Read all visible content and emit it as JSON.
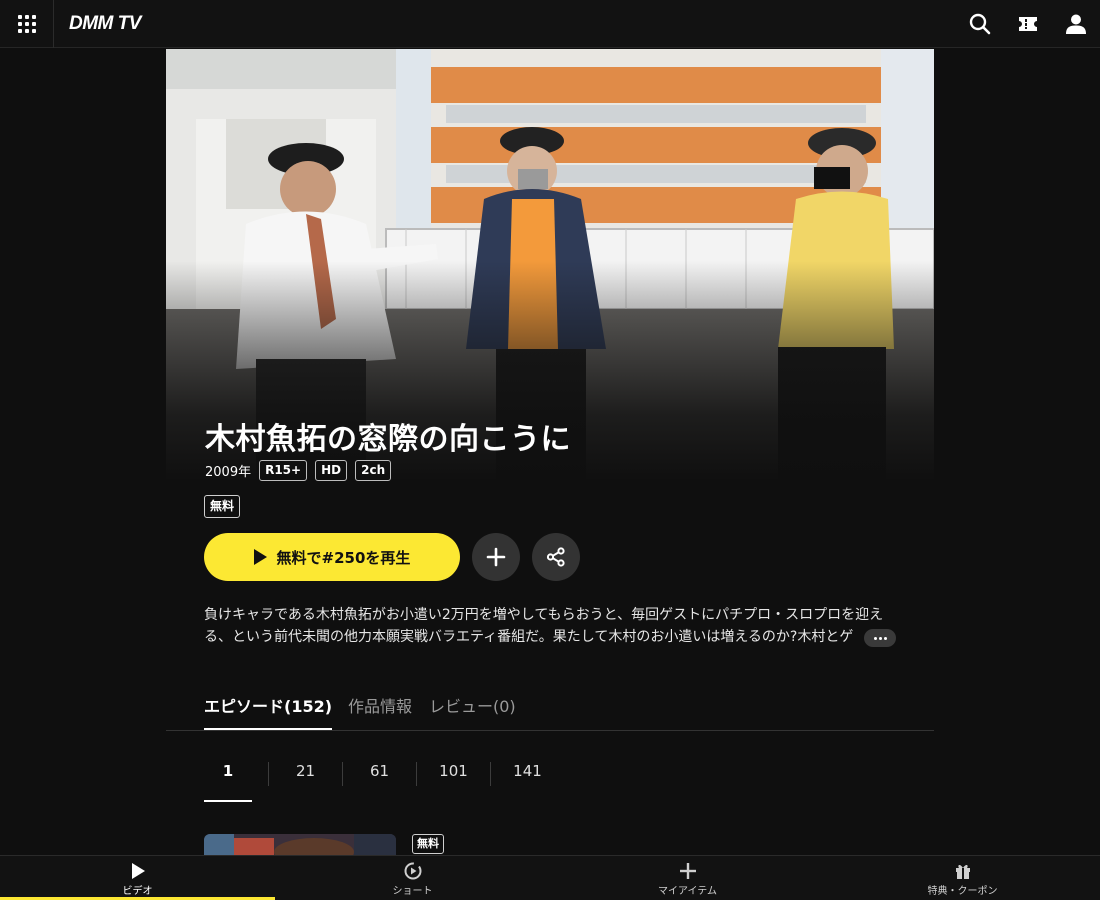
{
  "header": {
    "logo": "DMM TV",
    "icons": [
      "menu-grid-icon",
      "search-icon",
      "ticket-icon",
      "user-icon"
    ]
  },
  "title": {
    "name": "木村魚拓の窓際の向こうに",
    "year": "2009年",
    "tags": [
      "R15+",
      "HD",
      "2ch"
    ],
    "free_badge": "無料"
  },
  "actions": {
    "play_label": "無料で#250を再生",
    "add_icon": "plus-icon",
    "share_icon": "share-icon"
  },
  "description": "負けキャラである木村魚拓がお小遣い2万円を増やしてもらおうと、毎回ゲストにパチプロ・スロプロを迎える、という前代未聞の他力本願実戦バラエティ番組だ。果たして木村のお小遣いは増えるのか?木村とゲ",
  "tabs": [
    {
      "label": "エピソード(152)",
      "active": true
    },
    {
      "label": "作品情報",
      "active": false
    },
    {
      "label": "レビュー(0)",
      "active": false
    }
  ],
  "pages": [
    "1",
    "21",
    "61",
    "101",
    "141"
  ],
  "episode": {
    "free_badge": "無料"
  },
  "bottom_nav": [
    {
      "label": "ビデオ",
      "icon": "play-icon",
      "active": true
    },
    {
      "label": "ショート",
      "icon": "short-play-icon",
      "active": false
    },
    {
      "label": "マイアイテム",
      "icon": "plus-icon",
      "active": false
    },
    {
      "label": "特典・クーポン",
      "icon": "gift-icon",
      "active": false
    }
  ],
  "colors": {
    "accent": "#fce833",
    "background": "#0f0f0f"
  }
}
